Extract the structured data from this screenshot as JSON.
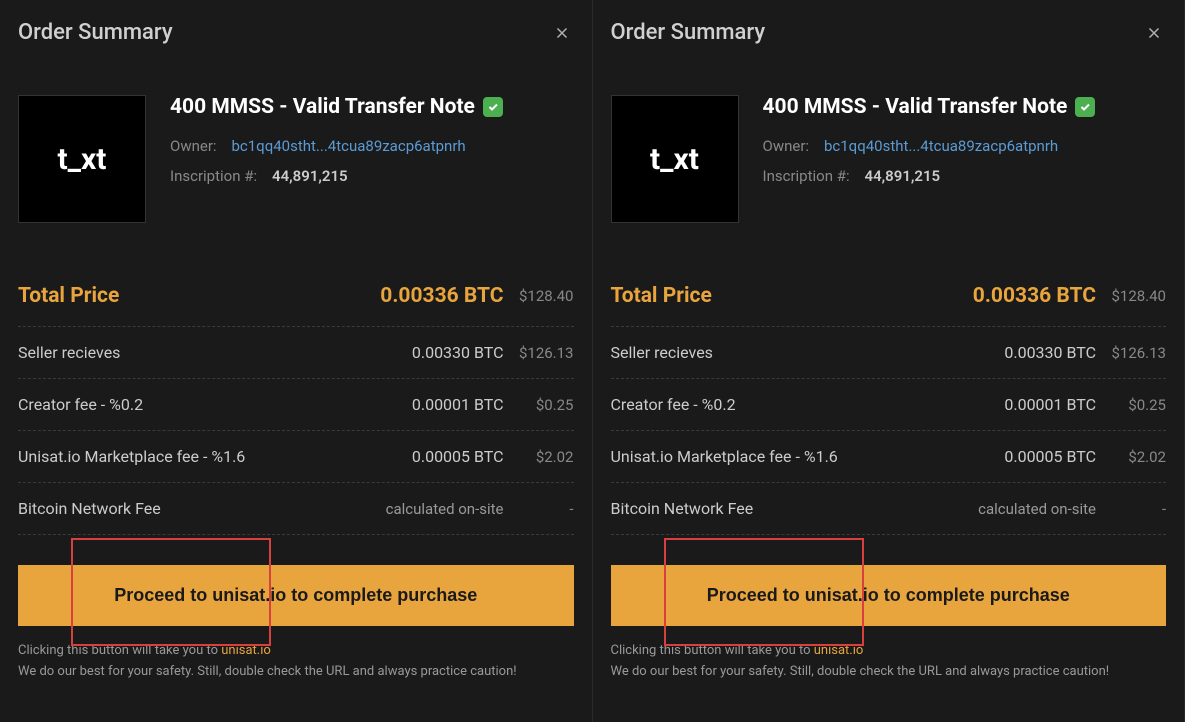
{
  "panels": [
    {
      "title": "Order Summary",
      "thumbnail_text": "t_xt",
      "item_title": "400 MMSS - Valid Transfer Note",
      "owner_label": "Owner:",
      "owner_address": "bc1qq40stht...4tcua89zacp6atpnrh",
      "inscription_label": "Inscription #:",
      "inscription_number": "44,891,215",
      "rows": {
        "total": {
          "label": "Total Price",
          "btc": "0.00336 BTC",
          "usd": "$128.40"
        },
        "seller": {
          "label": "Seller recieves",
          "btc": "0.00330 BTC",
          "usd": "$126.13"
        },
        "creator": {
          "label": "Creator fee - %0.2",
          "btc": "0.00001 BTC",
          "usd": "$0.25"
        },
        "marketplace": {
          "label": "Unisat.io Marketplace fee - %1.6",
          "btc": "0.00005 BTC",
          "usd": "$2.02"
        },
        "network": {
          "label": "Bitcoin Network Fee",
          "btc": "calculated on-site",
          "usd": "-"
        }
      },
      "proceed_label": "Proceed to unisat.io to complete purchase",
      "footer_prefix": "Clicking this button will take you to ",
      "footer_link": "unisat.io",
      "footer_warning": "We do our best for your safety. Still, double check the URL and always practice caution!"
    },
    {
      "title": "Order Summary",
      "thumbnail_text": "t_xt",
      "item_title": "400 MMSS - Valid Transfer Note",
      "owner_label": "Owner:",
      "owner_address": "bc1qq40stht...4tcua89zacp6atpnrh",
      "inscription_label": "Inscription #:",
      "inscription_number": "44,891,215",
      "rows": {
        "total": {
          "label": "Total Price",
          "btc": "0.00336 BTC",
          "usd": "$128.40"
        },
        "seller": {
          "label": "Seller recieves",
          "btc": "0.00330 BTC",
          "usd": "$126.13"
        },
        "creator": {
          "label": "Creator fee - %0.2",
          "btc": "0.00001 BTC",
          "usd": "$0.25"
        },
        "marketplace": {
          "label": "Unisat.io Marketplace fee - %1.6",
          "btc": "0.00005 BTC",
          "usd": "$2.02"
        },
        "network": {
          "label": "Bitcoin Network Fee",
          "btc": "calculated on-site",
          "usd": "-"
        }
      },
      "proceed_label": "Proceed to unisat.io to complete purchase",
      "footer_prefix": "Clicking this button will take you to ",
      "footer_link": "unisat.io",
      "footer_warning": "We do our best for your safety. Still, double check the URL and always practice caution!"
    }
  ]
}
